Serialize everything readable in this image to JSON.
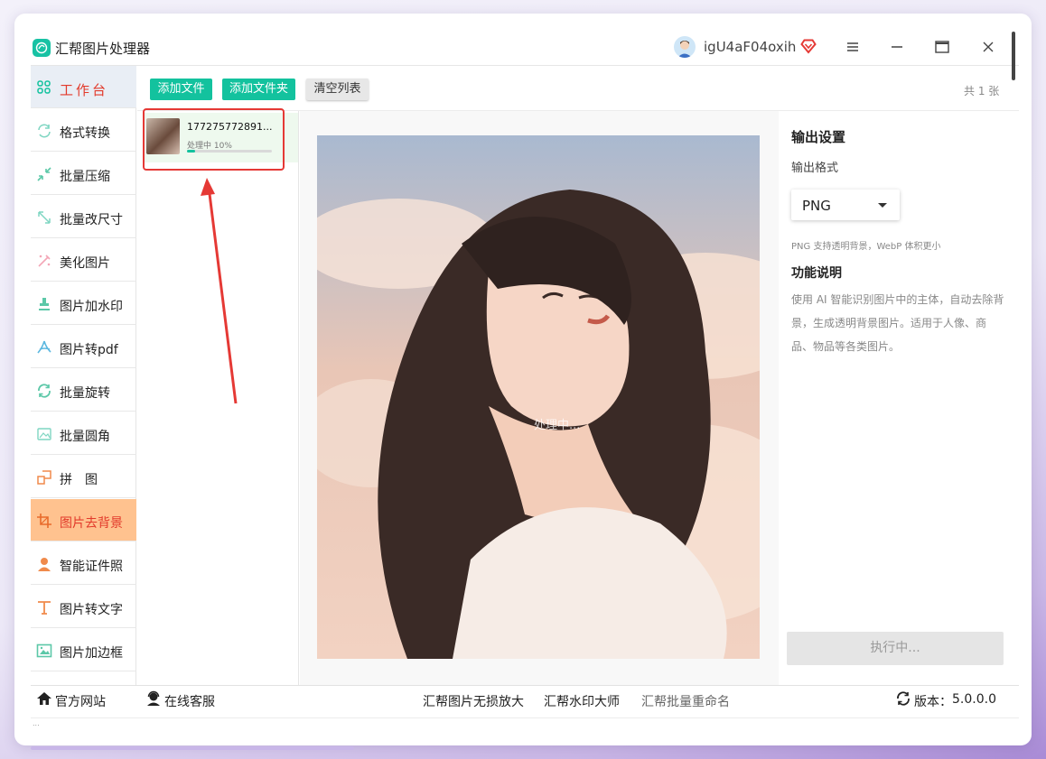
{
  "app": {
    "title": "汇帮图片处理器",
    "username": "igU4aF04oxih",
    "colors": {
      "accent_green": "#13c29e",
      "active_orange": "#ffc28f",
      "active_red": "#e23a2b"
    }
  },
  "sidebar": {
    "items": [
      {
        "label": "工作台",
        "icon": "workbench-grid-icon"
      },
      {
        "label": "格式转换",
        "icon": "format-convert-icon"
      },
      {
        "label": "批量压缩",
        "icon": "compress-icon"
      },
      {
        "label": "批量改尺寸",
        "icon": "resize-icon"
      },
      {
        "label": "美化图片",
        "icon": "beautify-icon"
      },
      {
        "label": "图片加水印",
        "icon": "watermark-stamp-icon"
      },
      {
        "label": "图片转pdf",
        "icon": "pdf-icon"
      },
      {
        "label": "批量旋转",
        "icon": "rotate-icon"
      },
      {
        "label": "批量圆角",
        "icon": "rounded-corner-icon"
      },
      {
        "label": "拼　图",
        "icon": "collage-icon"
      },
      {
        "label": "图片去背景",
        "icon": "crop-background-icon"
      },
      {
        "label": "智能证件照",
        "icon": "id-photo-person-icon"
      },
      {
        "label": "图片转文字",
        "icon": "text-t-icon"
      },
      {
        "label": "图片加边框",
        "icon": "frame-image-icon"
      }
    ],
    "active_index": 10
  },
  "toolbar": {
    "add_file": "添加文件",
    "add_folder": "添加文件夹",
    "clear_list": "清空列表",
    "count": "共 1 张"
  },
  "file_list": [
    {
      "name": "177275772891...",
      "status": "处理中 10%",
      "progress_pct": 10
    }
  ],
  "preview": {
    "status_text": "处理中..."
  },
  "settings": {
    "title": "输出设置",
    "format_label": "输出格式",
    "format_value": "PNG",
    "format_hint": "PNG 支持透明背景，WebP 体积更小",
    "func_title": "功能说明",
    "func_desc": "使用 AI 智能识别图片中的主体，自动去除背景，生成透明背景图片。适用于人像、商品、物品等各类图片。",
    "execute_button": "执行中..."
  },
  "bottom": {
    "website": "官方网站",
    "support": "在线客服",
    "link1": "汇帮图片无损放大",
    "link2": "汇帮水印大师",
    "link3": "汇帮批量重命名",
    "version_label": "版本：",
    "version": "5.0.0.0",
    "tiny": "..."
  }
}
